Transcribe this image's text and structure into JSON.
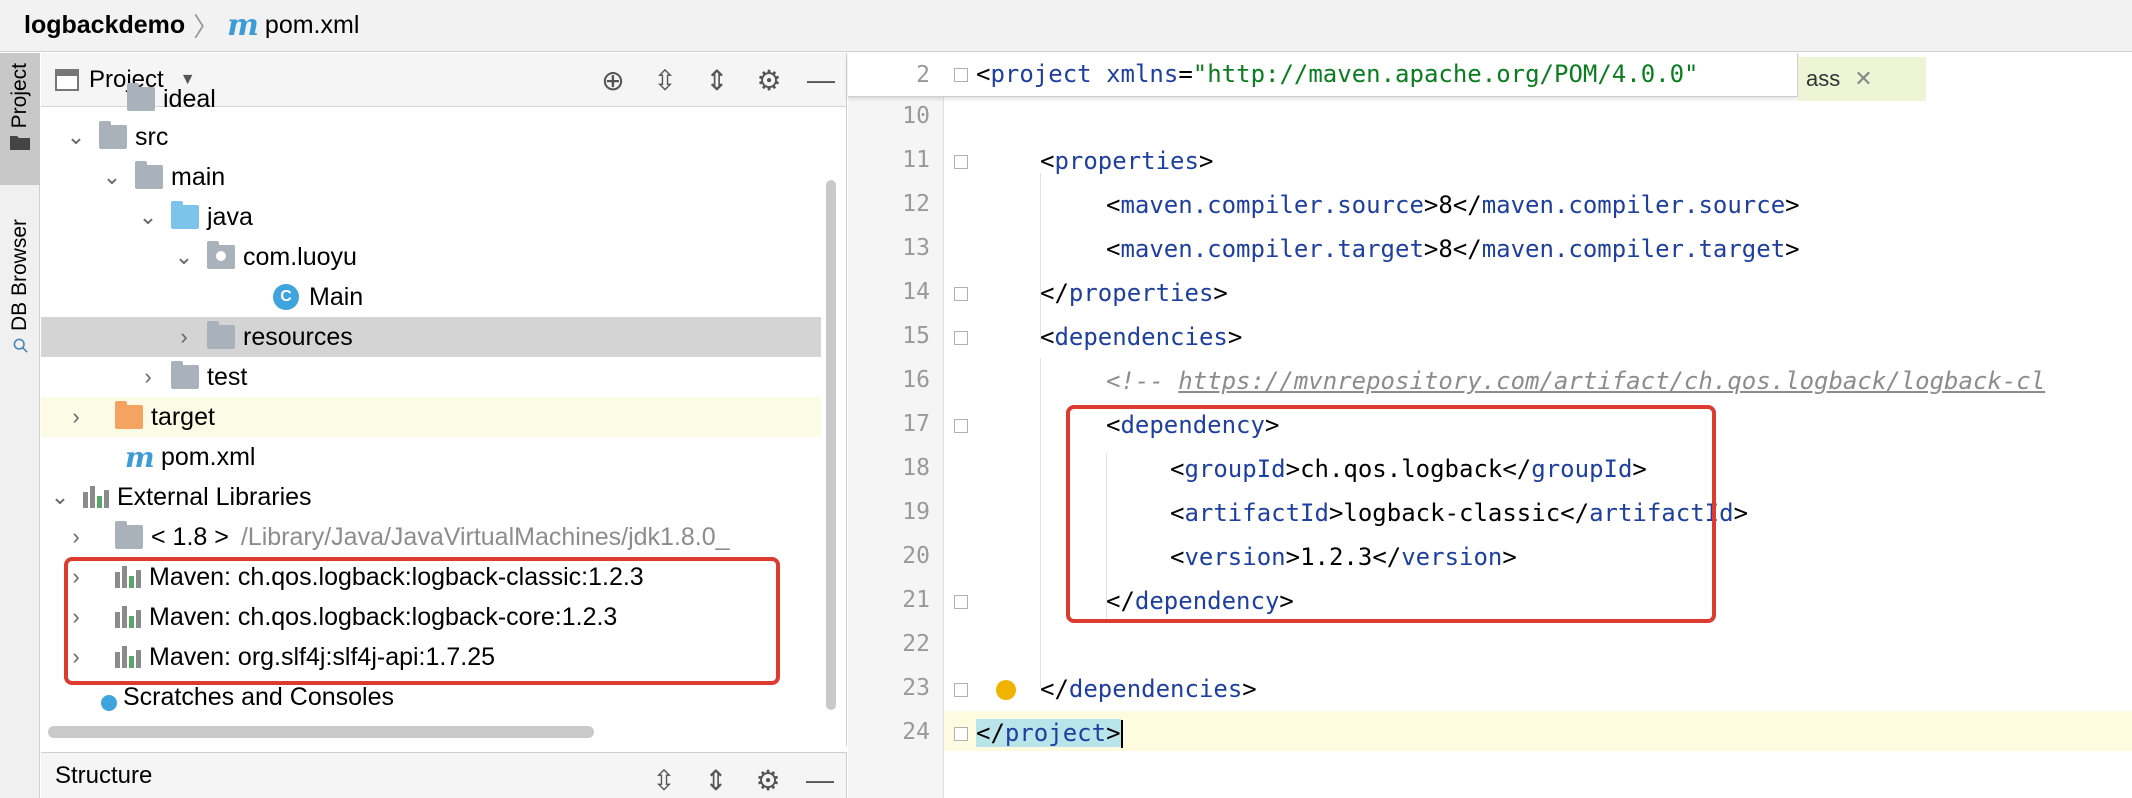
{
  "breadcrumb": {
    "project": "logbackdemo",
    "separator": "〉",
    "file": "pom.xml",
    "file_icon": "m"
  },
  "tool_strip": {
    "tab_project": "Project",
    "tab_db_browser": "DB Browser"
  },
  "project_panel": {
    "title": "Project",
    "tools": [
      "locate-icon",
      "expand-all-icon",
      "collapse-all-icon",
      "gear-icon",
      "minimize-icon"
    ]
  },
  "tree": {
    "partial_top": "ideal",
    "src": "src",
    "main": "main",
    "java": "java",
    "pkg": "com.luoyu",
    "main_class": "Main",
    "resources": "resources",
    "test": "test",
    "target": "target",
    "pom": "pom.xml",
    "external_libraries": "External Libraries",
    "jdk_name": "< 1.8 >",
    "jdk_path": "/Library/Java/JavaVirtualMachines/jdk1.8.0_",
    "maven_libs": [
      "Maven: ch.qos.logback:logback-classic:1.2.3",
      "Maven: ch.qos.logback:logback-core:1.2.3",
      "Maven: org.slf4j:slf4j-api:1.7.25"
    ],
    "scratches": "Scratches and Consoles"
  },
  "structure_panel": {
    "title": "Structure"
  },
  "editor": {
    "sticky_line": {
      "num": "2",
      "text": "<project xmlns=\"http://maven.apache.org/POM/4.0.0\""
    },
    "tab_chip": {
      "label": "ass",
      "close": "✕"
    },
    "lines": [
      {
        "num": "10"
      },
      {
        "num": "11",
        "open": "properties"
      },
      {
        "num": "12",
        "tag": "maven.compiler.source",
        "value": "8"
      },
      {
        "num": "13",
        "tag": "maven.compiler.target",
        "value": "8"
      },
      {
        "num": "14",
        "close": "properties"
      },
      {
        "num": "15",
        "open": "dependencies"
      },
      {
        "num": "16",
        "comment_prefix": "<!-- ",
        "comment_url": "https://mvnrepository.com/artifact/ch.qos.logback/logback-cl"
      },
      {
        "num": "17",
        "open": "dependency"
      },
      {
        "num": "18",
        "tag": "groupId",
        "value": "ch.qos.logback"
      },
      {
        "num": "19",
        "tag": "artifactId",
        "value": "logback-classic"
      },
      {
        "num": "20",
        "tag": "version",
        "value": "1.2.3"
      },
      {
        "num": "21",
        "close": "dependency"
      },
      {
        "num": "22"
      },
      {
        "num": "23",
        "close": "dependencies"
      },
      {
        "num": "24",
        "close": "project"
      }
    ]
  },
  "colors": {
    "tag": "#1f3f9e",
    "string": "#0a7d1f",
    "comment": "#8c8c8c",
    "annotation_box": "#dd3a30",
    "selection": "#d4d4d4"
  }
}
